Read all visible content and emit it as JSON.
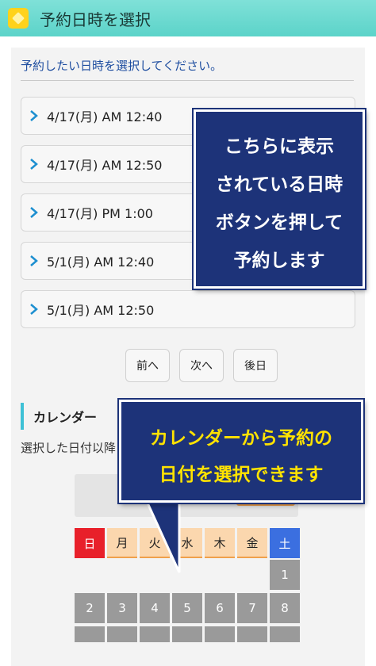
{
  "header": {
    "title": "予約日時を選択",
    "logo_icon": "yellow-cube-logo"
  },
  "main": {
    "instruction": "予約したい日時を選択してください。",
    "slots": [
      {
        "label": "4/17(月) AM 12:40"
      },
      {
        "label": "4/17(月) AM 12:50"
      },
      {
        "label": "4/17(月) PM 1:00"
      },
      {
        "label": "5/1(月) AM 12:40"
      },
      {
        "label": "5/1(月) AM 12:50"
      }
    ],
    "pager": {
      "prev": "前へ",
      "next": "次へ",
      "last": "後日"
    }
  },
  "calendar": {
    "title": "カレンダー",
    "description": "選択した日付以降",
    "weekdays": [
      "日",
      "月",
      "火",
      "水",
      "木",
      "金",
      "土"
    ],
    "week1": [
      "1"
    ],
    "week2": [
      "2",
      "3",
      "4",
      "5",
      "6",
      "7",
      "8"
    ]
  },
  "callouts": {
    "top": [
      "こちらに表示",
      "されている日時",
      "ボタンを押して",
      "予約します"
    ],
    "bottom": [
      "カレンダーから予約の",
      "日付を選択できます"
    ]
  },
  "colors": {
    "header_bg": "#5cd3c9",
    "callout_bg": "#1d3379",
    "callout_top_text": "#ffffff",
    "callout_bottom_text": "#ffe300",
    "sunday": "#e8202a",
    "saturday": "#3b6fe0",
    "weekday_bg": "#fbd7ae",
    "accent_chevron": "#1d8fd0"
  }
}
